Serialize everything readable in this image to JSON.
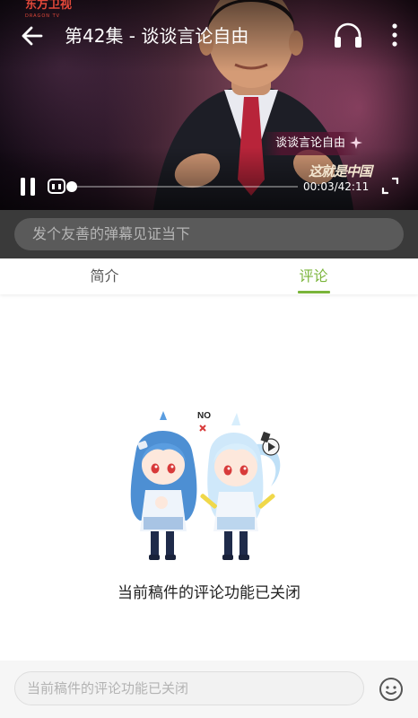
{
  "player": {
    "channel_logo": "东方卫视",
    "channel_logo_sub": "DRAGON TV",
    "title": "第42集 - 谈谈言论自由",
    "on_screen_caption": "谈谈言论自由",
    "watermark": "这就是中国",
    "time_readout": "00:03/42:11",
    "progress_fraction": 0.0012,
    "state": "playing",
    "icons": {
      "back": "arrow-left",
      "audio": "headphones",
      "more": "vertical-dots",
      "pause": "pause",
      "danmaku": "danmaku-toggle",
      "fullscreen": "fullscreen-corners"
    }
  },
  "danmaku": {
    "placeholder": "发个友善的弹幕见证当下"
  },
  "tabs": [
    {
      "label": "简介",
      "active": false
    },
    {
      "label": "评论",
      "active": true
    }
  ],
  "empty_state": {
    "bubble_text": "NO",
    "message": "当前稿件的评论功能已关闭"
  },
  "comment_bar": {
    "placeholder": "当前稿件的评论功能已关闭",
    "emoji_icon": "smiley-face"
  },
  "colors": {
    "accent": "#7ab53a",
    "danmaku_bar": "#3a3a3a",
    "danmaku_input": "#5a5a5a",
    "logo_red": "#e2483a"
  }
}
